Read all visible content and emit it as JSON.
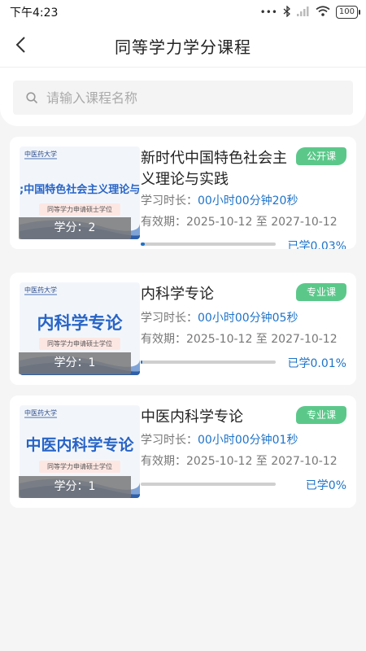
{
  "status_bar": {
    "time": "下午4:23",
    "dots": "•••",
    "battery": "100",
    "icons": [
      "bluetooth-icon",
      "signal-icon",
      "wifi-icon",
      "battery-icon"
    ]
  },
  "header": {
    "title": "同等学力学分课程",
    "back_icon": "chevron-left-icon"
  },
  "search": {
    "placeholder": "请输入课程名称",
    "value": ""
  },
  "cover_common": {
    "logo_text": "中医药大学",
    "subtitle": "同等学力申请硕士学位"
  },
  "courses": [
    {
      "name": "新时代中国特色社会主义理论与实践",
      "tag": "公开课",
      "cover_title": ";中国特色社会主义理论与",
      "credit": "学分：2",
      "duration_label": "学习时长：",
      "duration_value": "00小时00分钟20秒",
      "validity": "有效期：2025-10-12 至 2027-10-12",
      "progress_text": "已学0.03%",
      "progress": 0.03
    },
    {
      "name": "内科学专论",
      "tag": "专业课",
      "cover_title": "内科学专论",
      "credit": "学分：1",
      "duration_label": "学习时长：",
      "duration_value": "00小时00分钟05秒",
      "validity": "有效期：2025-10-12 至 2027-10-12",
      "progress_text": "已学0.01%",
      "progress": 0.01
    },
    {
      "name": "中医内科学专论",
      "tag": "专业课",
      "cover_title": "中医内科学专论",
      "credit": "学分：1",
      "duration_label": "学习时长：",
      "duration_value": "00小时00分钟01秒",
      "validity": "有效期：2025-10-12 至 2027-10-12",
      "progress_text": "已学0%",
      "progress": 0
    }
  ],
  "colors": {
    "accent_blue": "#1e73c9",
    "tag_green": "#5bc88a",
    "cover_title_blue": "#2864c6"
  }
}
